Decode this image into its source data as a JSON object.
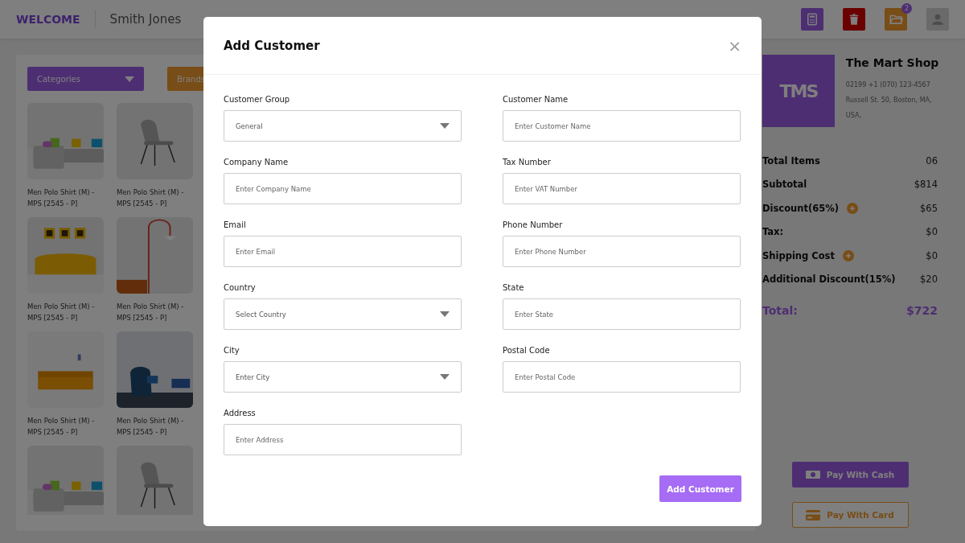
{
  "header": {
    "welcome": "WELCOME",
    "user_name": "Smith Jones",
    "icons": [
      {
        "kind": "calculator"
      },
      {
        "kind": "trash"
      },
      {
        "kind": "folder",
        "badge": "2"
      },
      {
        "kind": "user"
      }
    ]
  },
  "filters": [
    {
      "label": "Categories",
      "kind": "category"
    },
    {
      "label": "Brands",
      "kind": "brand"
    }
  ],
  "products": [
    {
      "name": "Men Polo Shirt (M) - MPS [2545 - P]",
      "kind": "sofa"
    },
    {
      "name": "Men Polo Shirt (M) - MPS [2545 - P]",
      "kind": "chair"
    },
    {
      "name": "Men Polo Shirt (M) - MPS [2545 - P]",
      "kind": "yellow-sofa"
    },
    {
      "name": "Men Polo Shirt (M) - MPS [2545 - P]",
      "kind": "lamp"
    },
    {
      "name": "Men Polo Shirt (M) - MPS [2545 - P]",
      "kind": "orange-sofa"
    },
    {
      "name": "Men Polo Shirt (M) - MPS [2545 - P]",
      "kind": "armchair"
    },
    {
      "kind": "sofa"
    },
    {
      "kind": "chair"
    }
  ],
  "shop": {
    "logo": "TMS",
    "name": "The Mart Shop",
    "phone": "02199 +1 (070) 123-4567",
    "address": "Russell St. 50, Boston, MA, USA,"
  },
  "summary": [
    {
      "label": "Total Items",
      "value": "06",
      "addable": false
    },
    {
      "label": "Subtotal",
      "value": "$814",
      "addable": false
    },
    {
      "label": "Discount(65%)",
      "value": "$65",
      "addable": true
    },
    {
      "label": "Tax:",
      "value": "$0",
      "addable": false
    },
    {
      "label": "Shipping Cost",
      "value": "$0",
      "addable": true
    },
    {
      "label": "Additional Discount(15%)",
      "value": "$20",
      "addable": false
    }
  ],
  "total": {
    "label": "Total:",
    "value": "$722"
  },
  "pay_buttons": [
    {
      "label": "Pay With Cash",
      "kind": "cash"
    },
    {
      "label": "Pay With Card",
      "kind": "card"
    }
  ],
  "modal": {
    "title": "Add Customer",
    "close": "×",
    "fields": [
      {
        "label": "Customer Group",
        "kind": "select",
        "value": "General"
      },
      {
        "label": "Customer Name",
        "kind": "input",
        "placeholder": "Enter Customer Name"
      },
      {
        "label": "Company Name",
        "kind": "input",
        "placeholder": "Enter Company Name"
      },
      {
        "label": "Tax Number",
        "kind": "input",
        "placeholder": "Enter VAT Number"
      },
      {
        "label": "Email",
        "kind": "input",
        "placeholder": "Enter Email"
      },
      {
        "label": "Phone Number",
        "kind": "input",
        "placeholder": "Enter Phone Number"
      },
      {
        "label": "Country",
        "kind": "select",
        "value": "Select Country"
      },
      {
        "label": "State",
        "kind": "input",
        "placeholder": "Enter State"
      },
      {
        "label": "City",
        "kind": "select",
        "value": "Enter City"
      },
      {
        "label": "Postal Code",
        "kind": "input",
        "placeholder": "Enter Postal Code"
      },
      {
        "label": "Address",
        "kind": "input",
        "placeholder": "Enter Address"
      }
    ],
    "submit": "Add Customer"
  }
}
